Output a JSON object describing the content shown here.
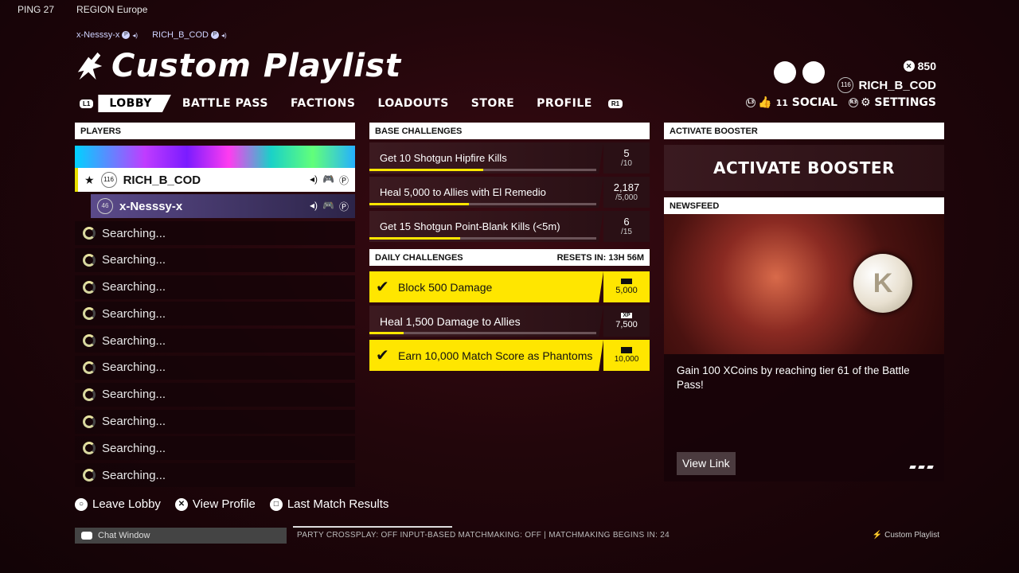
{
  "top": {
    "ping": "PING 27",
    "region": "REGION Europe"
  },
  "party": [
    "x-Nesssy-x",
    "RICH_B_COD"
  ],
  "title": "Custom Playlist",
  "nav": {
    "left_bumper": "L1",
    "right_bumper": "R1",
    "tabs": [
      "LOBBY",
      "BATTLE PASS",
      "FACTIONS",
      "LOADOUTS",
      "STORE",
      "PROFILE"
    ]
  },
  "profile": {
    "coins": "850",
    "level": "116",
    "username": "RICH_B_COD",
    "social_btn": "L3",
    "social_count": "11",
    "social_label": "SOCIAL",
    "settings_btn": "R3",
    "settings_label": "SETTINGS"
  },
  "players": {
    "header": "PLAYERS",
    "p1": {
      "level": "116",
      "name": "RICH_B_COD"
    },
    "p2": {
      "level": "46",
      "name": "x-Nesssy-x"
    },
    "searching": [
      "Searching...",
      "Searching...",
      "Searching...",
      "Searching...",
      "Searching...",
      "Searching...",
      "Searching...",
      "Searching...",
      "Searching...",
      "Searching..."
    ]
  },
  "base_challenges": {
    "header": "BASE CHALLENGES",
    "items": [
      {
        "label": "Get 10 Shotgun Hipfire Kills",
        "value": "5",
        "total": "/10",
        "progress": 0.5
      },
      {
        "label": "Heal 5,000 to Allies with El Remedio",
        "value": "2,187",
        "total": "/5,000",
        "progress": 0.44
      },
      {
        "label": "Get 15 Shotgun Point-Blank Kills (<5m)",
        "value": "6",
        "total": "/15",
        "progress": 0.4
      }
    ]
  },
  "daily_challenges": {
    "header": "DAILY CHALLENGES",
    "reset": "RESETS IN: 13H 56M",
    "xp_tag": "XP",
    "items": [
      {
        "label": "Block 500 Damage",
        "xp": "5,000",
        "done": true
      },
      {
        "label": "Heal 1,500 Damage to Allies",
        "xp": "7,500",
        "done": false,
        "progress": 0.15
      },
      {
        "label": "Earn 10,000 Match Score as Phantoms",
        "xp": "10,000",
        "done": true
      }
    ]
  },
  "booster": {
    "header": "ACTIVATE BOOSTER",
    "button": "ACTIVATE BOOSTER"
  },
  "news": {
    "header": "NEWSFEED",
    "text": "Gain 100 XCoins by reaching tier 61 of the Battle Pass!",
    "link": "View Link"
  },
  "actions": [
    {
      "icon": "○",
      "label": "Leave Lobby"
    },
    {
      "icon": "✕",
      "label": "View Profile"
    },
    {
      "icon": "□",
      "label": "Last Match Results"
    }
  ],
  "footer": {
    "chat": "Chat Window",
    "status": "PARTY  CROSSPLAY: OFF  INPUT-BASED MATCHMAKING: OFF  |  MATCHMAKING BEGINS IN: 24",
    "mode": "Custom Playlist"
  }
}
